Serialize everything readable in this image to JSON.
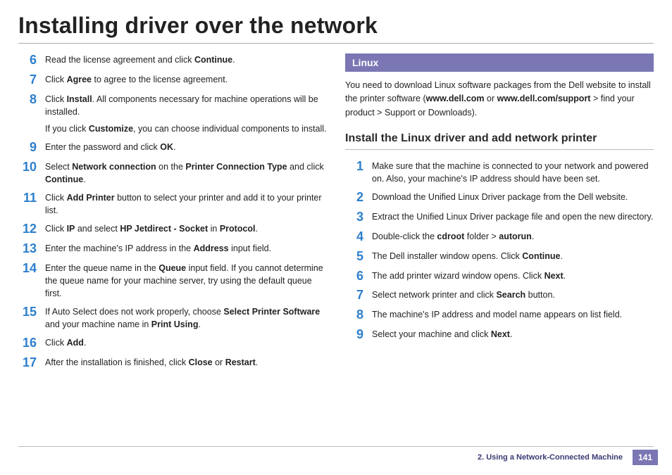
{
  "title": "Installing driver over the network",
  "left_steps": [
    {
      "n": "6",
      "paras": [
        [
          {
            "t": "Read the license agreement and click "
          },
          {
            "t": "Continue",
            "b": true
          },
          {
            "t": "."
          }
        ]
      ]
    },
    {
      "n": "7",
      "paras": [
        [
          {
            "t": "Click "
          },
          {
            "t": "Agree",
            "b": true
          },
          {
            "t": " to agree to the license agreement."
          }
        ]
      ]
    },
    {
      "n": "8",
      "paras": [
        [
          {
            "t": "Click "
          },
          {
            "t": "Install",
            "b": true
          },
          {
            "t": ". All components necessary for machine operations will be installed."
          }
        ],
        [
          {
            "t": "If you click "
          },
          {
            "t": "Customize",
            "b": true
          },
          {
            "t": ", you can choose individual components to install."
          }
        ]
      ]
    },
    {
      "n": "9",
      "paras": [
        [
          {
            "t": "Enter the password and click "
          },
          {
            "t": "OK",
            "b": true
          },
          {
            "t": "."
          }
        ]
      ]
    },
    {
      "n": "10",
      "paras": [
        [
          {
            "t": "Select "
          },
          {
            "t": "Network connection",
            "b": true
          },
          {
            "t": " on the "
          },
          {
            "t": "Printer Connection Type",
            "b": true
          },
          {
            "t": " and click "
          },
          {
            "t": "Continue",
            "b": true
          },
          {
            "t": "."
          }
        ]
      ]
    },
    {
      "n": "11",
      "paras": [
        [
          {
            "t": "Click "
          },
          {
            "t": "Add Printer",
            "b": true
          },
          {
            "t": " button to select your printer and add it to your printer list."
          }
        ]
      ]
    },
    {
      "n": "12",
      "paras": [
        [
          {
            "t": "Click "
          },
          {
            "t": "IP",
            "b": true
          },
          {
            "t": " and select "
          },
          {
            "t": "HP Jetdirect - Socket",
            "b": true
          },
          {
            "t": " in "
          },
          {
            "t": "Protocol",
            "b": true
          },
          {
            "t": "."
          }
        ]
      ]
    },
    {
      "n": "13",
      "paras": [
        [
          {
            "t": "Enter the machine's IP address in the "
          },
          {
            "t": "Address",
            "b": true
          },
          {
            "t": " input field."
          }
        ]
      ]
    },
    {
      "n": "14",
      "paras": [
        [
          {
            "t": "Enter the queue name in the "
          },
          {
            "t": "Queue",
            "b": true
          },
          {
            "t": " input field. If you cannot determine the queue name for your machine server, try using the default queue first."
          }
        ]
      ]
    },
    {
      "n": "15",
      "paras": [
        [
          {
            "t": "If Auto Select does not work properly, choose "
          },
          {
            "t": "Select Printer Software",
            "b": true
          },
          {
            "t": " and your machine name in "
          },
          {
            "t": "Print Using",
            "b": true
          },
          {
            "t": "."
          }
        ]
      ]
    },
    {
      "n": "16",
      "paras": [
        [
          {
            "t": "Click "
          },
          {
            "t": "Add",
            "b": true
          },
          {
            "t": "."
          }
        ]
      ]
    },
    {
      "n": "17",
      "paras": [
        [
          {
            "t": "After the installation is finished, click "
          },
          {
            "t": "Close",
            "b": true
          },
          {
            "t": " or "
          },
          {
            "t": "Restart",
            "b": true
          },
          {
            "t": "."
          }
        ]
      ]
    }
  ],
  "right": {
    "section_title": "Linux",
    "intro_runs": [
      {
        "t": "You need to download Linux software packages from the Dell website to install the printer software ("
      },
      {
        "t": "www.dell.com",
        "b": true
      },
      {
        "t": " or "
      },
      {
        "t": "www.dell.com/support",
        "b": true
      },
      {
        "t": "  > find your product > Support or Downloads)."
      }
    ],
    "subhead": "Install the Linux driver and add network printer",
    "steps": [
      {
        "n": "1",
        "paras": [
          [
            {
              "t": "Make sure that the machine is connected to your network and powered on. Also, your machine's IP address should have been set."
            }
          ]
        ]
      },
      {
        "n": "2",
        "paras": [
          [
            {
              "t": "Download the Unified Linux Driver package from the Dell website."
            }
          ]
        ]
      },
      {
        "n": "3",
        "paras": [
          [
            {
              "t": "Extract the Unified Linux Driver package file and open the new directory."
            }
          ]
        ]
      },
      {
        "n": "4",
        "paras": [
          [
            {
              "t": "Double-click the "
            },
            {
              "t": "cdroot",
              "b": true
            },
            {
              "t": " folder > "
            },
            {
              "t": "autorun",
              "b": true
            },
            {
              "t": "."
            }
          ]
        ]
      },
      {
        "n": "5",
        "paras": [
          [
            {
              "t": "The Dell installer window opens. Click "
            },
            {
              "t": "Continue",
              "b": true
            },
            {
              "t": "."
            }
          ]
        ]
      },
      {
        "n": "6",
        "paras": [
          [
            {
              "t": "The add printer wizard window opens. Click "
            },
            {
              "t": "Next",
              "b": true
            },
            {
              "t": "."
            }
          ]
        ]
      },
      {
        "n": "7",
        "paras": [
          [
            {
              "t": "Select network printer and click "
            },
            {
              "t": "Search",
              "b": true
            },
            {
              "t": " button."
            }
          ]
        ]
      },
      {
        "n": "8",
        "paras": [
          [
            {
              "t": "The machine's IP address and model name appears on list field."
            }
          ]
        ]
      },
      {
        "n": "9",
        "paras": [
          [
            {
              "t": "Select your machine and click "
            },
            {
              "t": "Next",
              "b": true
            },
            {
              "t": "."
            }
          ]
        ]
      }
    ]
  },
  "footer": {
    "label": "2.  Using a Network-Connected Machine",
    "page": "141"
  }
}
